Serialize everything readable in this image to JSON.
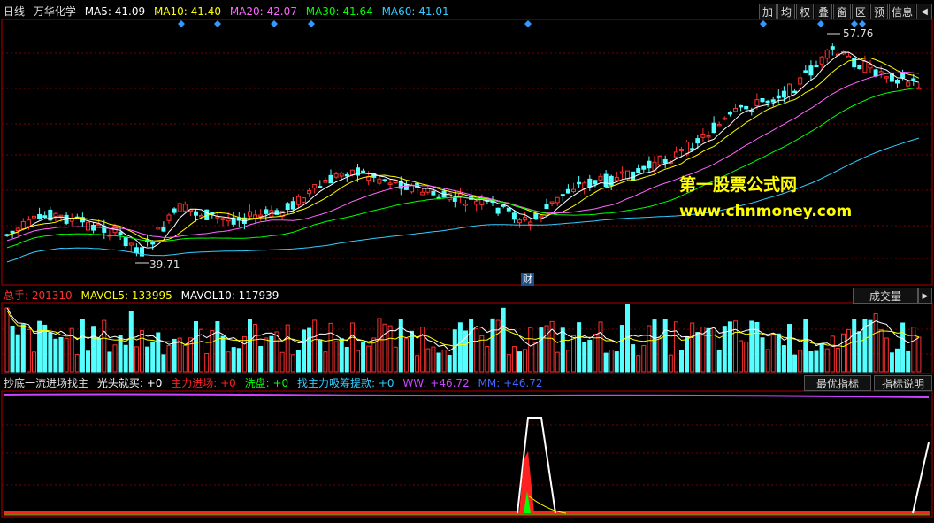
{
  "header": {
    "period": "日线",
    "stock_name": "万华化学",
    "ma": [
      {
        "label": "MA5: 41.09",
        "color": "#ffffff"
      },
      {
        "label": "MA10: 41.40",
        "color": "#ffff00"
      },
      {
        "label": "MA20: 42.07",
        "color": "#ff66ff"
      },
      {
        "label": "MA30: 41.64",
        "color": "#00ff00"
      },
      {
        "label": "MA60: 41.01",
        "color": "#33ccff"
      }
    ]
  },
  "toolbar": {
    "buttons": [
      "加",
      "均",
      "权",
      "叠",
      "窗",
      "区",
      "预",
      "信息"
    ],
    "close_glyph": "◀"
  },
  "price": {
    "high_label": "57.76",
    "low_label": "39.71",
    "event_marker": "财"
  },
  "watermark": {
    "line1": "第一股票公式网",
    "line2": "www.chnmoney.com"
  },
  "volume_panel": {
    "total_label": "总手: 201310",
    "mavol5": "MAVOL5: 133995",
    "mavol10": "MAVOL10: 117939",
    "button": "成交量"
  },
  "indicator_panel": {
    "name": "抄底一流进场找主",
    "items": [
      {
        "label": "光头就买: +0",
        "color": "#ffffff"
      },
      {
        "label": "主力进场: +0",
        "color": "#ff2020"
      },
      {
        "label": "洗盘: +0",
        "color": "#00ff00"
      },
      {
        "label": "找主力吸筹提款: +0",
        "color": "#33ccff"
      },
      {
        "label": "WW: +46.72",
        "color": "#cc44ff"
      },
      {
        "label": "MM: +46.72",
        "color": "#4466ff"
      }
    ],
    "buttons": [
      "最优指标",
      "指标说明"
    ]
  },
  "colors": {
    "up": "#ff3030",
    "down": "#54ffff",
    "grid": "#7a0000",
    "frame": "#b00000"
  }
}
